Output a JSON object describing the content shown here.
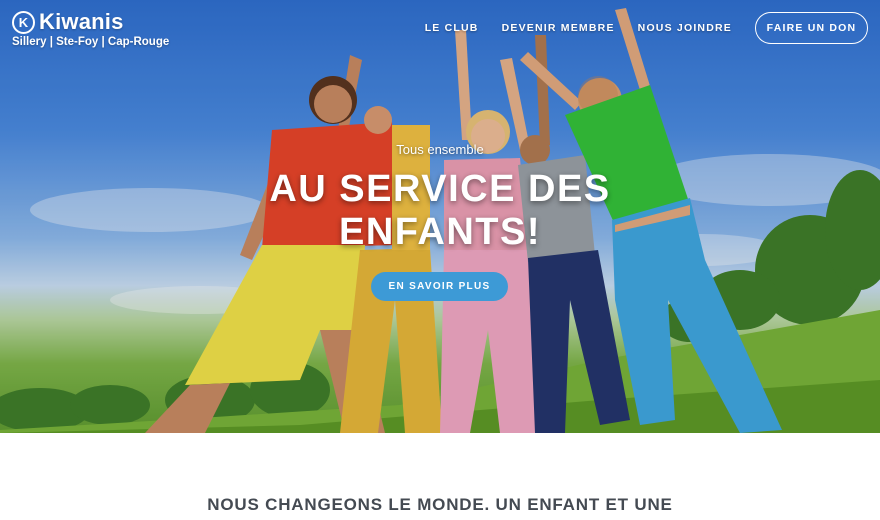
{
  "brand": {
    "logo_mark": "K",
    "name": "Kiwanis",
    "subtitle": "Sillery | Ste-Foy | Cap-Rouge"
  },
  "nav": {
    "items": [
      {
        "label": "LE CLUB"
      },
      {
        "label": "DEVENIR MEMBRE"
      },
      {
        "label": "NOUS JOINDRE"
      }
    ],
    "donate_label": "FAIRE UN DON"
  },
  "hero": {
    "tagline": "Tous ensemble",
    "headline_line1": "AU SERVICE DES",
    "headline_line2": "ENFANTS!",
    "cta_label": "EN SAVOIR PLUS",
    "image": "children-jumping-in-field-photo"
  },
  "mission": {
    "heading": "NOUS CHANGEONS LE MONDE. UN ENFANT ET UNE"
  },
  "colors": {
    "cta": "#3d9ad6",
    "heading_text": "#444a52",
    "white": "#ffffff"
  }
}
